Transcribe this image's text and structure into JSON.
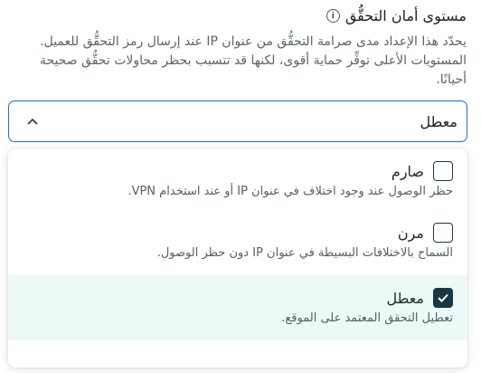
{
  "header": {
    "title": "مستوى أمان التحقُّق",
    "info_icon": "info-icon",
    "description": "يحدّد هذا الإعداد مدى صرامة التحقُّق من عنوان IP عند إرسال رمز التحقُّق للعميل. المستويات الأعلى توفِّر حماية أقوى، لكنها قد تتسبب بحظر محاولات تحقُّق صحيحة أحيانًا."
  },
  "select": {
    "value": "معطل",
    "chevron_icon": "chevron-up-icon"
  },
  "options": [
    {
      "label": "صارم",
      "description": "حظر الوصول عند وجود اختلاف في عنوان IP أو عند استخدام VPN.",
      "checked": false
    },
    {
      "label": "مرن",
      "description": "السماح بالاختلافات البسيطة في عنوان IP دون حظر الوصول.",
      "checked": false
    },
    {
      "label": "معطل",
      "description": "تعطيل التحقق المعتمد على الموقع.",
      "checked": true
    }
  ],
  "colors": {
    "accent_border": "#1d6fd8",
    "checkbox_checked": "#173845",
    "selected_row": "#edf9f6"
  }
}
